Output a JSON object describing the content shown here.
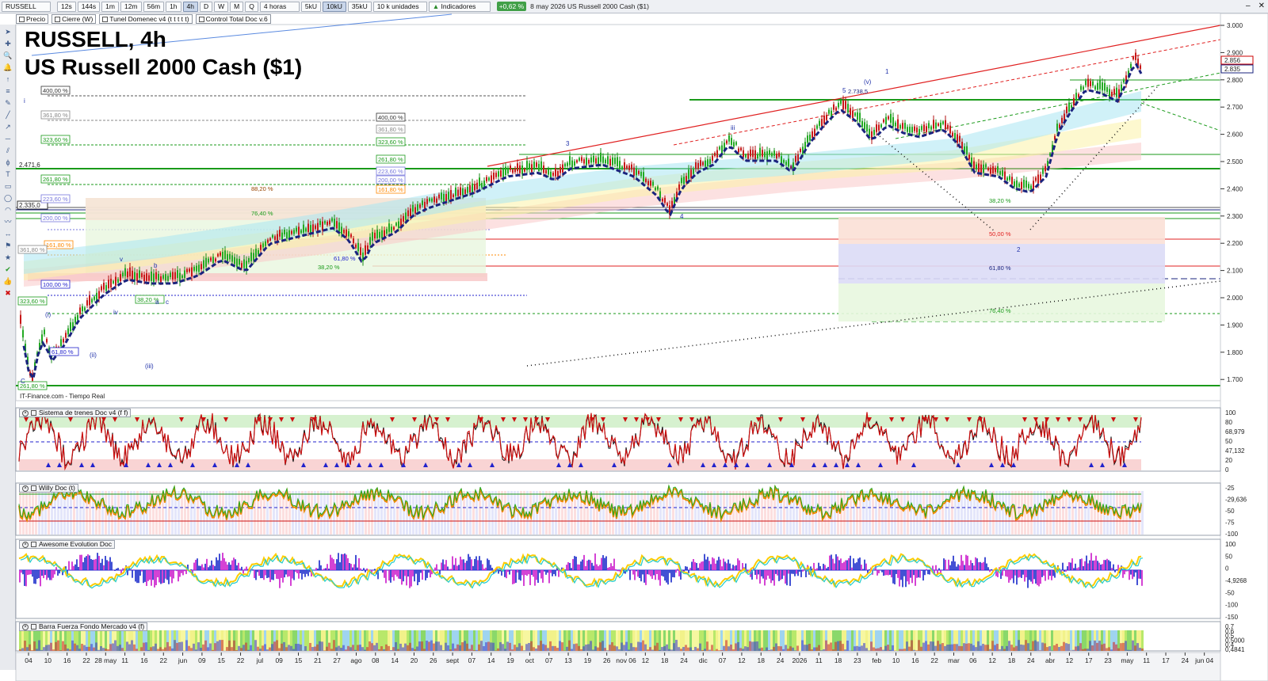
{
  "toolbar": {
    "symbol": "RUSSELL",
    "timeframes": [
      "12s",
      "144s",
      "1m",
      "12m",
      "56m",
      "1h",
      "4h",
      "D",
      "W",
      "M",
      "Q"
    ],
    "active_timeframe": "4h",
    "period_select": "4 horas",
    "sizes": [
      "5kU",
      "10kU",
      "35kU"
    ],
    "active_size": "10kU",
    "units_select": "10 k unidades",
    "indicators_label": "Indicadores",
    "change_badge": "+0,62 %",
    "info": "8 may 2026  US Russell 2000 Cash ($1)"
  },
  "legend": {
    "items": [
      "Precio",
      "Cierre (W)",
      "Tunel Domenec v4 (t t t t t)",
      "Control Total Doc v.6"
    ]
  },
  "chart": {
    "title": "RUSSELL, 4h",
    "subtitle": "US Russell 2000 Cash ($1)",
    "datasource": "IT-Finance.com - Tiempo Real",
    "price_axis": [
      "3.000",
      "2.900",
      "2.800",
      "2.700",
      "2.600",
      "2.500",
      "2.400",
      "2.300",
      "2.200",
      "2.100",
      "2.000",
      "1.900",
      "1.800",
      "1.700"
    ],
    "price_tags": [
      "2.856",
      "2.835",
      "2.471,6",
      "2.335,0"
    ],
    "fib_labels_left": [
      "400,00 %",
      "361,80 %",
      "323,60 %",
      "261,80 %",
      "223,60 %",
      "200,00 %",
      "161,80 %",
      "100,00 %",
      "61,80 %",
      "38,20 %",
      "323,60 %",
      "361,80 %",
      "261,80 %"
    ],
    "fib_labels_mid": [
      "400,00 %",
      "361,80 %",
      "323,60 %",
      "261,80 %",
      "223,60 %",
      "200,00 %",
      "161,80 %",
      "88,20 %",
      "76,40 %",
      "61,80 %",
      "38,20 %"
    ],
    "fib_labels_right": [
      "61,80 %",
      "76,40 %",
      "38,20 %",
      "50,00 %"
    ],
    "wave_labels": [
      "1",
      "2",
      "3",
      "4",
      "5",
      "(v)",
      "(i)",
      "(ii)",
      "(iii)",
      "i",
      "ii",
      "iii",
      "iv",
      "v",
      "a",
      "b",
      "c",
      "C"
    ],
    "annotation_price": "2.738,5"
  },
  "panes": [
    {
      "title": "Sistema de trenes Doc v4 (f f)",
      "axis": [
        "100",
        "80",
        "68,979",
        "50",
        "47,132",
        "20",
        "0"
      ]
    },
    {
      "title": "Willy Doc (t)",
      "axis": [
        "-25",
        "-29,636",
        "-50",
        "-75",
        "-100"
      ]
    },
    {
      "title": "Awesome Evolution Doc",
      "axis": [
        "100",
        "50",
        "0",
        "-4,9268",
        "-50",
        "-100",
        "-150"
      ]
    },
    {
      "title": "Barra Fuerza Fondo Mercado v4 (f)",
      "axis": [
        "0,7",
        "0,6",
        "0,5",
        "0,5000",
        "0,4",
        "0,4841"
      ]
    }
  ],
  "date_axis": [
    "04",
    "10",
    "16",
    "22",
    "28 may",
    "11",
    "16",
    "22",
    "jun",
    "09",
    "15",
    "22",
    "jul",
    "09",
    "15",
    "21",
    "27",
    "ago",
    "08",
    "14",
    "20",
    "26",
    "sept",
    "07",
    "14",
    "19",
    "oct",
    "07",
    "13",
    "19",
    "26",
    "nov 06",
    "12",
    "18",
    "24",
    "dic",
    "07",
    "12",
    "18",
    "24",
    "2026",
    "11",
    "18",
    "23",
    "feb",
    "10",
    "16",
    "22",
    "mar",
    "06",
    "12",
    "18",
    "24",
    "abr",
    "12",
    "17",
    "23",
    "may",
    "11",
    "17",
    "24",
    "jun 04"
  ],
  "colors": {
    "accent": "#41a048",
    "resistance_red": "#e02020",
    "support_green": "#1a9a1a",
    "trend_blue": "#1a237e"
  },
  "tools": [
    "cursor-icon",
    "crosshair-icon",
    "zoom-icon",
    "bell-icon",
    "arrow-up-icon",
    "list-icon",
    "pencil-icon",
    "line-icon",
    "ray-icon",
    "hline-icon",
    "channel-icon",
    "fib-icon",
    "text-icon",
    "rect-icon",
    "ellipse-icon",
    "arc-icon",
    "path-icon",
    "measure-icon",
    "flag-icon",
    "star-icon",
    "check-icon",
    "thumb-icon",
    "delete-icon"
  ]
}
